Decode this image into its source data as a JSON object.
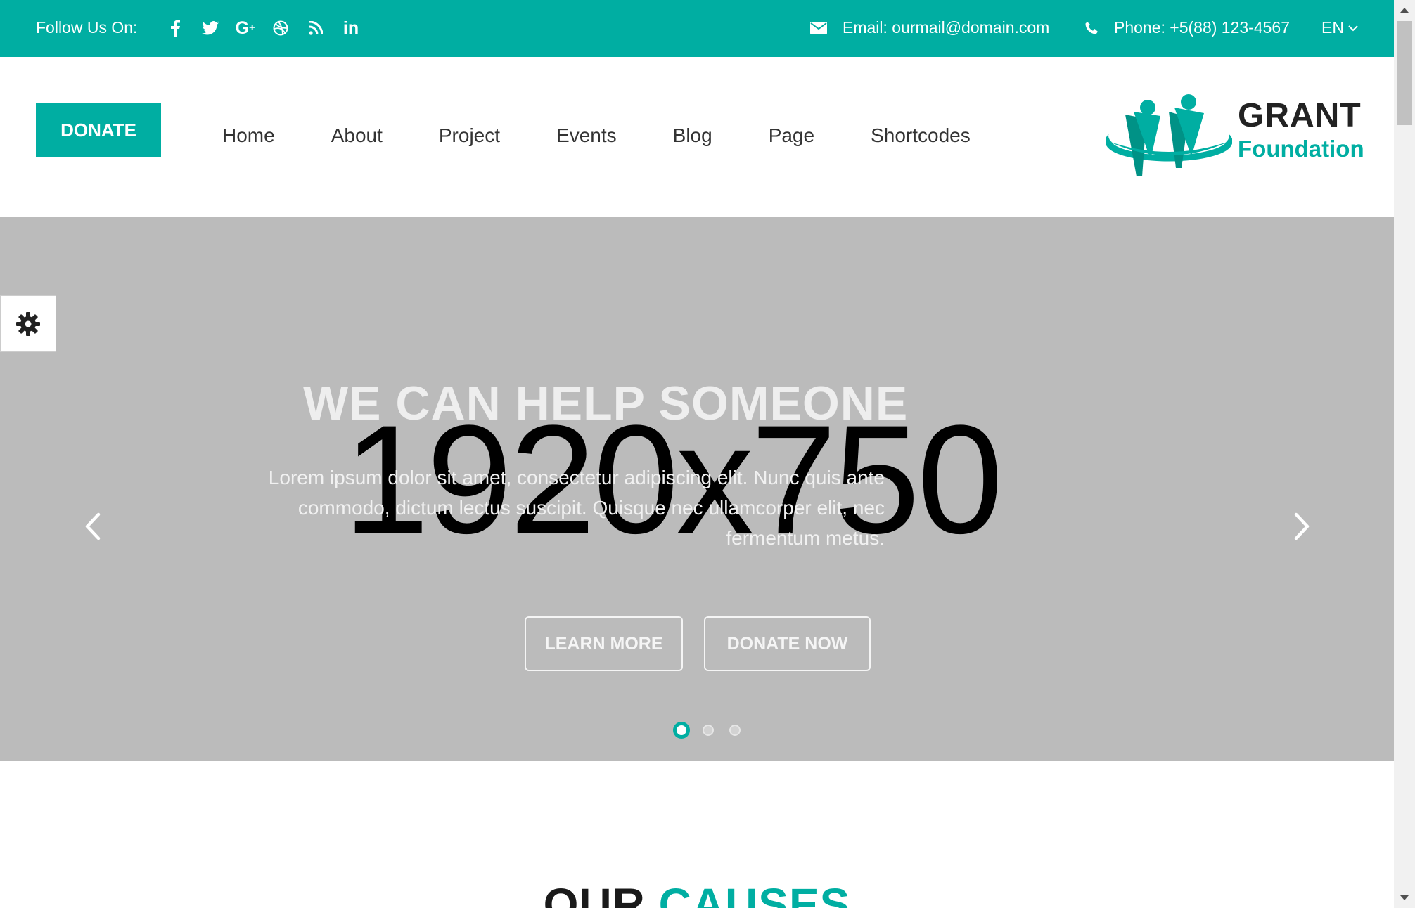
{
  "topbar": {
    "follow_label": "Follow Us On:",
    "social": [
      "facebook-icon",
      "twitter-icon",
      "google-plus-icon",
      "dribbble-icon",
      "rss-icon",
      "linkedin-icon"
    ],
    "social_glyphs": [
      "f",
      "🐦",
      "G+",
      "◎",
      "⟆",
      "in"
    ],
    "email": "Email: ourmail@domain.com",
    "phone": "Phone: +5(88) 123-4567",
    "language": "EN"
  },
  "header": {
    "donate_label": "DONATE",
    "nav": [
      "Home",
      "About",
      "Project",
      "Events",
      "Blog",
      "Page",
      "Shortcodes"
    ],
    "logo_line1": "GRANT",
    "logo_line2": "Foundation"
  },
  "hero": {
    "placeholder_text": "1920x750",
    "title": "WE CAN HELP SOMEONE",
    "text": "Lorem ipsum dolor sit amet, consectetur adipiscing elit. Nunc quis ante commodo, dictum lectus suscipit. Quisque nec ullamcorper elit, nec fermentum metus.",
    "learn_more": "LEARN MORE",
    "donate_now": "DONATE NOW",
    "slides_total": 3,
    "active_slide": 1
  },
  "causes": {
    "title_part1": "OUR",
    "title_part2": "CAUSES"
  },
  "colors": {
    "accent": "#00aea2",
    "hero_bg": "#bbbbbb",
    "text_dark": "#333333"
  }
}
